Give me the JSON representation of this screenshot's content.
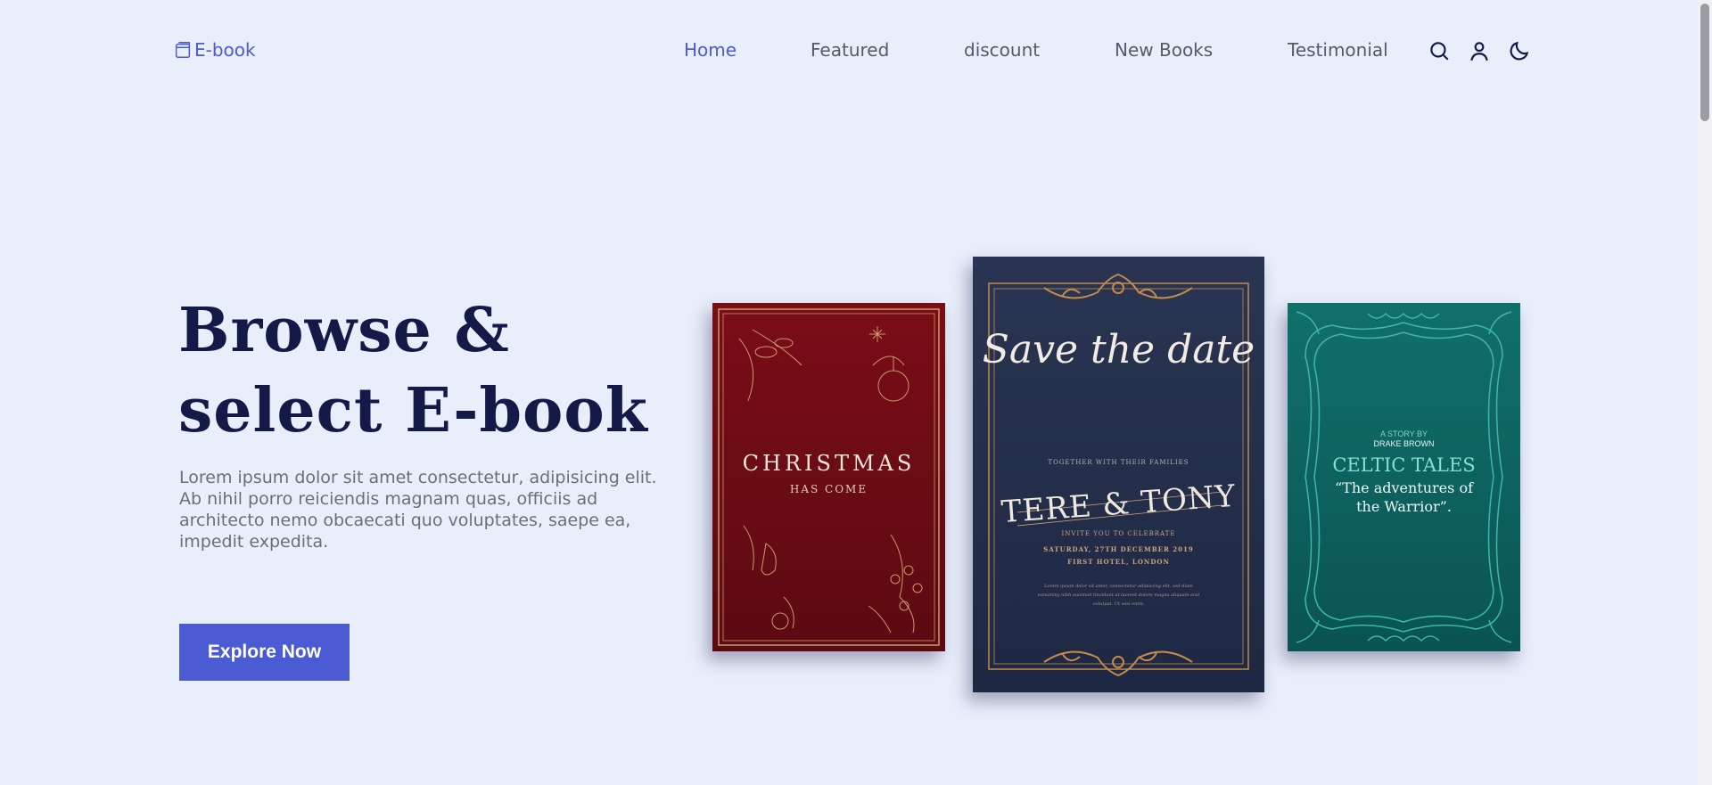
{
  "header": {
    "logo_text": "E-book",
    "nav": [
      {
        "label": "Home",
        "active": true
      },
      {
        "label": "Featured",
        "active": false
      },
      {
        "label": "discount",
        "active": false
      },
      {
        "label": "New Books",
        "active": false
      },
      {
        "label": "Testimonial",
        "active": false
      }
    ],
    "icons": [
      "search-icon",
      "user-icon",
      "moon-icon"
    ]
  },
  "hero": {
    "title_line1": "Browse &",
    "title_line2": "select E-book",
    "description": "Lorem ipsum dolor sit amet consectetur, adipisicing elit. Ab nihil porro reiciendis magnam quas, officiis ad architecto nemo obcaecati quo voluptates, saepe ea, impedit expedita.",
    "cta_label": "Explore Now"
  },
  "books": {
    "red": {
      "title": "CHRISTMAS",
      "subtitle": "HAS COME"
    },
    "navy": {
      "script": "Save the date",
      "together": "TOGETHER WITH THEIR FAMILIES",
      "names": "TERE & TONY",
      "invite": "INVITE YOU TO CELEBRATE",
      "date": "SATURDAY, 27TH DECEMBER 2019",
      "venue": "FIRST HOTEL, LONDON",
      "lorem": "Lorem ipsum dolor sit amet, consectetur adipiscing elit, sed diam nonummy nibh euismod tincidunt ut laoreet dolore magna aliquam erat volutpat. Ut wisi enim."
    },
    "teal": {
      "story_by": "A STORY BY",
      "author": "DRAKE BROWN",
      "title": "CELTIC TALES",
      "subtitle": "“The adventures of the Warrior”."
    }
  },
  "colors": {
    "background": "#e9eefb",
    "accent": "#4a5bd4",
    "heading": "#141a48",
    "body_text": "#6b6e7c"
  }
}
